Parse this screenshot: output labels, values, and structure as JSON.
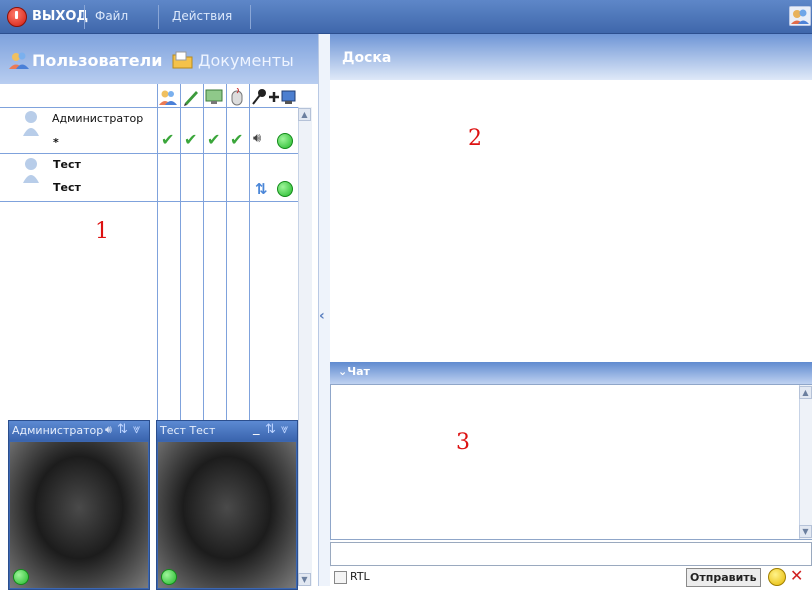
{
  "menubar": {
    "exit_label": "ВЫХОД",
    "file_label": "Файл",
    "actions_label": "Действия"
  },
  "left_panel": {
    "users_tab_label": "Пользователи",
    "documents_tab_label": "Документы"
  },
  "users": [
    {
      "name": "Администратор",
      "subtitle": "*",
      "checks": 4,
      "status": "online"
    },
    {
      "name": "Тест",
      "subtitle": "Тест",
      "checks": 0,
      "status": "online"
    }
  ],
  "videos": [
    {
      "title": "Администратор"
    },
    {
      "title": "Тест Тест"
    }
  ],
  "board": {
    "title": "Доска"
  },
  "chat": {
    "title": "Чат",
    "send_label": "Отправить",
    "rtl_label": "RTL",
    "input_value": ""
  },
  "annotations": {
    "one": "1",
    "two": "2",
    "three": "3"
  },
  "colors": {
    "accent": "#3f67ab",
    "online": "#21b82a",
    "check": "#3aa63a",
    "annotation": "#dd1111"
  }
}
